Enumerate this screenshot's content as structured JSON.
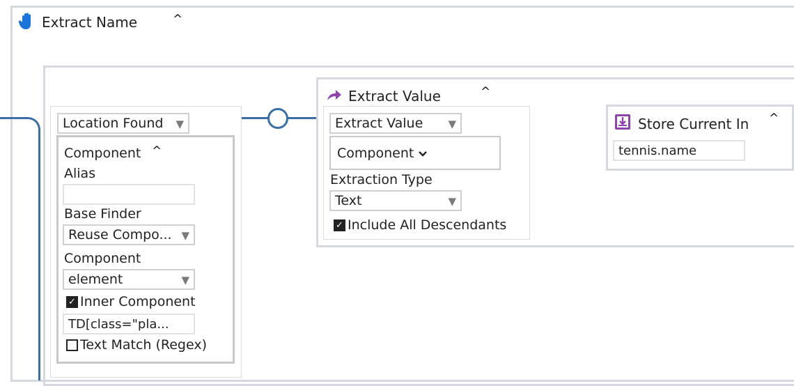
{
  "header": {
    "title": "Extract Name",
    "collapse_glyph": "^"
  },
  "location_block": {
    "select": "Location Found",
    "component_title": "Component",
    "alias_label": "Alias",
    "alias_value": "",
    "base_finder_label": "Base Finder",
    "base_finder_value": "Reuse Compo...",
    "component_label": "Component",
    "component_value": "element",
    "inner_component_label": "Inner Component",
    "inner_component_checked": true,
    "selector_value": "TD[class=\"pla...",
    "text_match_label": "Text Match (Regex)",
    "text_match_checked": false
  },
  "extract_block": {
    "title": "Extract Value",
    "select": "Extract Value",
    "component_toggle": "Component",
    "extraction_type_label": "Extraction Type",
    "extraction_type_value": "Text",
    "include_descendants_label": "Include All Descendants",
    "include_descendants_checked": true
  },
  "store_block": {
    "title": "Store Current In",
    "value": "tennis.name"
  },
  "icons": {
    "header": "hand-icon",
    "extract": "arrow-icon",
    "store": "download-icon",
    "select_arrow": "triangle-down-icon",
    "chevron": "chevron-down-icon"
  },
  "colors": {
    "blue_connector": "#3a6ea5",
    "purple_connector": "#9b59b6",
    "frame": "#d6d8e0"
  }
}
